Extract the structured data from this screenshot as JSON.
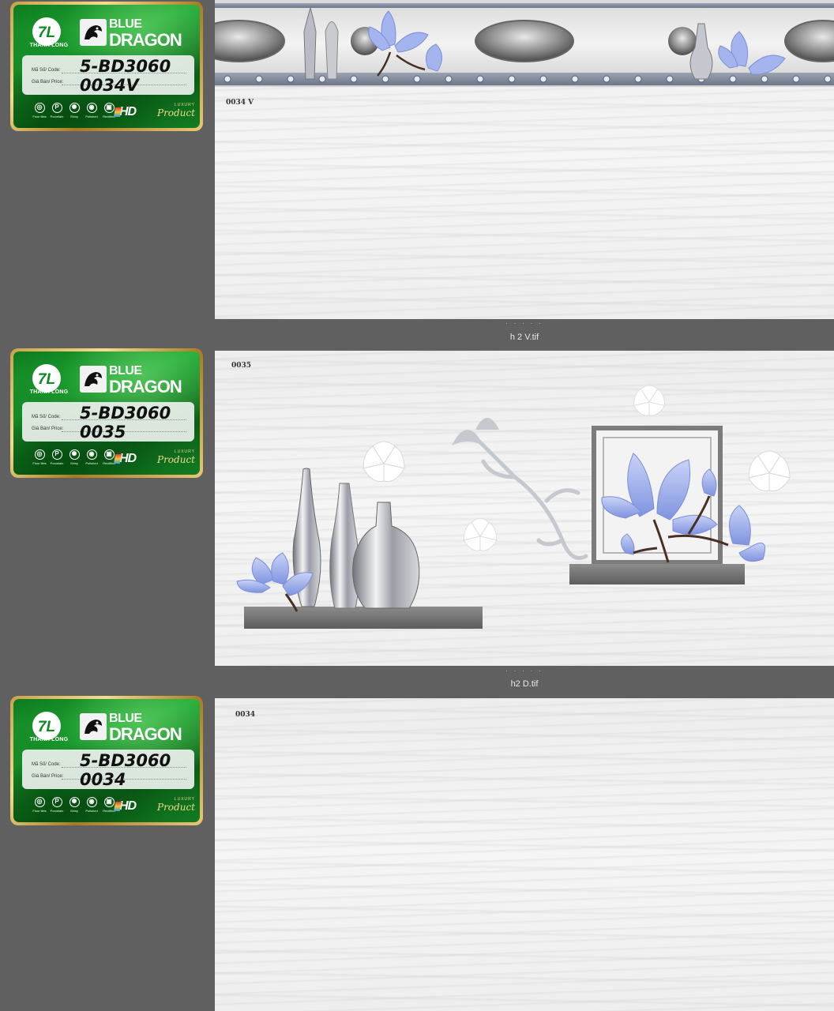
{
  "cards": [
    {
      "brand_short": "THANH LONG",
      "brand_top": "BLUE",
      "brand_main": "DRAGON",
      "code_label": "Mã Số/ Code:",
      "price_label": "Giá Bán/ Price:",
      "code_line1": "5-BD3060",
      "code_line2": "0034V",
      "features": [
        "Floor tiles",
        "Porcelain",
        "Shiny",
        "Polished",
        "Rectified"
      ],
      "hd": "HD",
      "luxury": "LUXURY",
      "product": "Product"
    },
    {
      "brand_short": "THANH LONG",
      "brand_top": "BLUE",
      "brand_main": "DRAGON",
      "code_label": "Mã Số/ Code:",
      "price_label": "Giá Bán/ Price:",
      "code_line1": "5-BD3060",
      "code_line2": "0035",
      "features": [
        "Floor tiles",
        "Porcelain",
        "Shiny",
        "Polished",
        "Rectified"
      ],
      "hd": "HD",
      "luxury": "LUXURY",
      "product": "Product"
    },
    {
      "brand_short": "THANH LONG",
      "brand_top": "BLUE",
      "brand_main": "DRAGON",
      "code_label": "Mã Số/ Code:",
      "price_label": "Giá Bán/ Price:",
      "code_line1": "5-BD3060",
      "code_line2": "0034",
      "features": [
        "Floor tiles",
        "Porcelain",
        "Shiny",
        "Polished",
        "Rectified"
      ],
      "hd": "HD",
      "luxury": "LUXURY",
      "product": "Product"
    }
  ],
  "tiles": [
    {
      "code": "0034 V"
    },
    {
      "code": "0035"
    },
    {
      "code": "0034"
    }
  ],
  "captions": [
    {
      "dots": ". . . . .",
      "text": "h 2 V.tif"
    },
    {
      "dots": ". . . . .",
      "text": "h2 D.tif"
    }
  ],
  "colors": {
    "background": "#606060",
    "card_green": "#1faa33",
    "card_gold": "#c9a24a",
    "accent_blue": "#8fa3e8"
  }
}
